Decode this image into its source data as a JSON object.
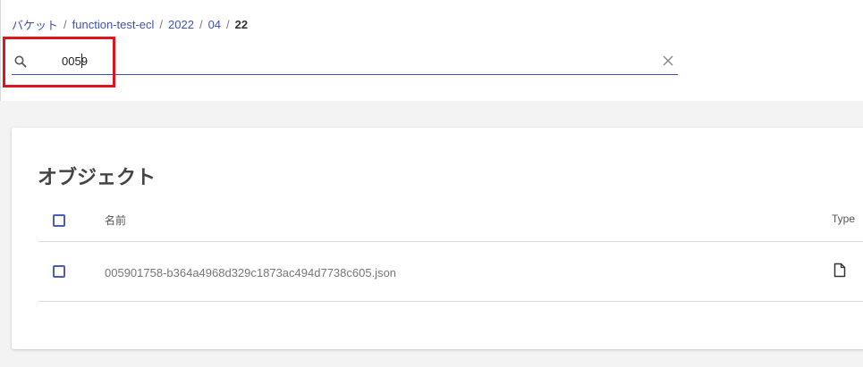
{
  "breadcrumb": {
    "items": [
      "バケット",
      "function-test-ecl",
      "2022",
      "04"
    ],
    "separator": "/",
    "current": "22"
  },
  "search": {
    "value": "0059",
    "placeholder": "",
    "search_icon": "search-icon",
    "clear_icon": "close-icon"
  },
  "objects": {
    "title": "オブジェクト",
    "columns": {
      "name": "名前",
      "type": "Type"
    },
    "rows": [
      {
        "name": "005901758-b364a4968d329c1873ac494d7738c605.json",
        "type_icon": "file-icon"
      }
    ]
  },
  "colors": {
    "accent": "#3f51b5",
    "highlight": "#e0151b",
    "content_background": "#f3f3f3"
  }
}
